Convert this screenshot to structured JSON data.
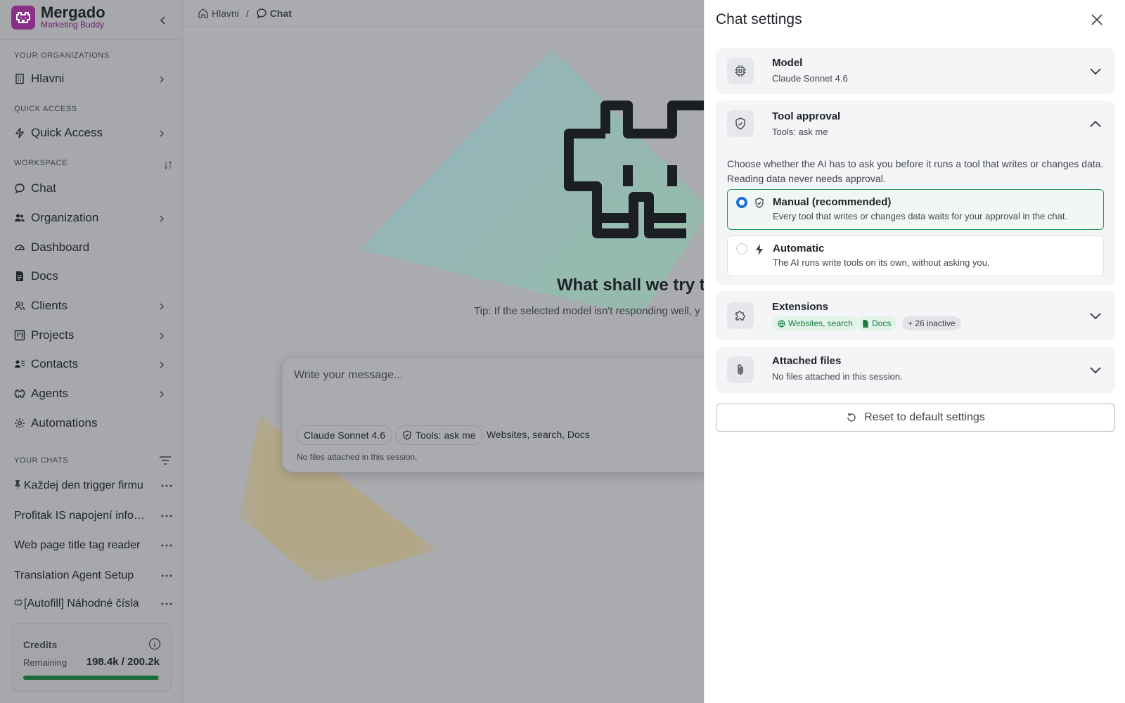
{
  "app": {
    "name": "Mergado",
    "subtitle": "Marketing Buddy"
  },
  "sidebar": {
    "sections": {
      "orgs": "YOUR ORGANIZATIONS",
      "quick": "QUICK ACCESS",
      "workspace": "WORKSPACE",
      "chats": "YOUR CHATS"
    },
    "org_item": "Hlavni",
    "quick_item": "Quick Access",
    "workspace_items": [
      "Chat",
      "Organization",
      "Dashboard",
      "Docs",
      "Clients",
      "Projects",
      "Contacts",
      "Agents",
      "Automations"
    ],
    "chats": [
      "Každej den trigger firmu",
      "Profitak IS napojení informace",
      "Web page title tag reader",
      "Translation Agent Setup",
      "[Autofill] Náhodné čísla"
    ]
  },
  "credits": {
    "title": "Credits",
    "remaining_label": "Remaining",
    "value": "198.4k / 200.2k",
    "fraction": 0.991
  },
  "breadcrumb": {
    "home": "Hlavni",
    "separator": "/",
    "current": "Chat"
  },
  "main": {
    "hero_title": "What shall we try t",
    "tip": "Tip: If the selected model isn't responding well, y",
    "composer": {
      "placeholder": "Write your message...",
      "model": "Claude Sonnet 4.6",
      "tools": "Tools: ask me",
      "extensions": "Websites, search, Docs",
      "files": "No files attached in this session."
    }
  },
  "panel": {
    "title": "Chat settings",
    "model": {
      "title": "Model",
      "value": "Claude Sonnet 4.6"
    },
    "tool_approval": {
      "title": "Tool approval",
      "value": "Tools: ask me",
      "description": "Choose whether the AI has to ask you before it runs a tool that writes or changes data. Reading data never needs approval.",
      "options": [
        {
          "label": "Manual (recommended)",
          "desc": "Every tool that writes or changes data waits for your approval in the chat.",
          "selected": true
        },
        {
          "label": "Automatic",
          "desc": "The AI runs write tools on its own, without asking you.",
          "selected": false
        }
      ]
    },
    "extensions": {
      "title": "Extensions",
      "tags": [
        "Websites, search",
        "Docs",
        "+ 26 inactive"
      ]
    },
    "files": {
      "title": "Attached files",
      "value": "No files attached in this session."
    },
    "reset": "Reset to default settings"
  },
  "colors": {
    "brand": "#8a2f87",
    "accent_green": "#1f9b57",
    "radio_blue": "#1d6fe0",
    "credit_bar": "#1d6b3b"
  }
}
